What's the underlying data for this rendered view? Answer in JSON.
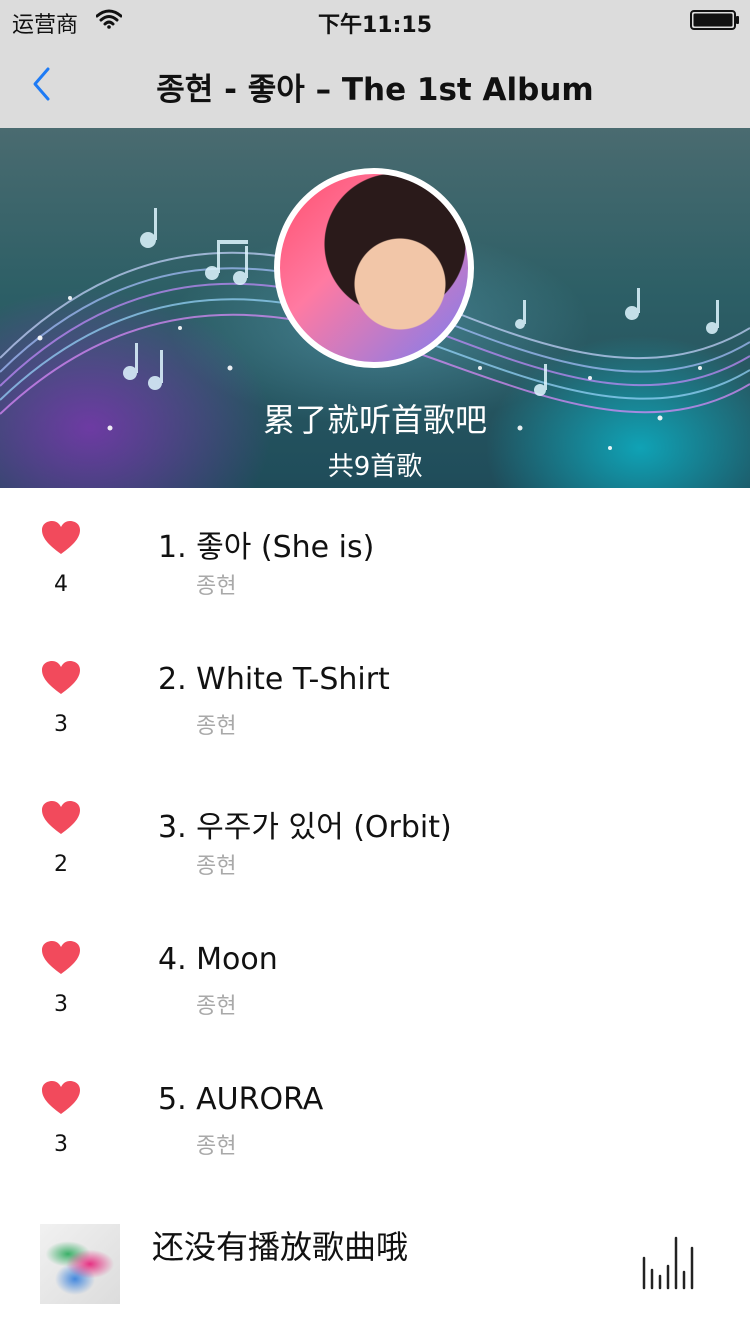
{
  "status_bar": {
    "carrier": "运营商",
    "time": "下午11:15",
    "icons": [
      "wifi-icon",
      "battery-icon"
    ]
  },
  "nav": {
    "back_icon": "chevron-left-icon",
    "title": "종현 - 좋아 – The 1st Album"
  },
  "header": {
    "subtitle": "累了就听首歌吧",
    "count_label": "共9首歌"
  },
  "songs": [
    {
      "title": "1. 좋아 (She is)",
      "artist": "종현",
      "likes": "4"
    },
    {
      "title": "2. White T-Shirt",
      "artist": "종현",
      "likes": "3"
    },
    {
      "title": "3. 우주가 있어 (Orbit)",
      "artist": "종현",
      "likes": "2"
    },
    {
      "title": "4. Moon",
      "artist": "종현",
      "likes": "3"
    },
    {
      "title": "5. AURORA",
      "artist": "종현",
      "likes": "3"
    }
  ],
  "player": {
    "status_text": "还没有播放歌曲哦",
    "playlist_icon": "playlist-bars-icon"
  },
  "colors": {
    "heart": "#f24a5c",
    "back_chevron": "#1e7bf5",
    "artist_text": "#a9a9a9",
    "bar_background": "#dcdcdc"
  }
}
